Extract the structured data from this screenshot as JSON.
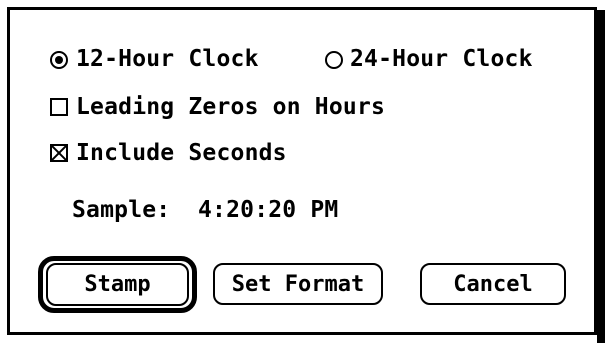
{
  "dialog": {
    "clock_options": [
      {
        "label": "12-Hour Clock",
        "selected": true
      },
      {
        "label": "24-Hour Clock",
        "selected": false
      }
    ],
    "leading_zeros": {
      "label": "Leading Zeros on Hours",
      "checked": false
    },
    "include_seconds": {
      "label": "Include Seconds",
      "checked": true
    },
    "sample": {
      "label": "Sample:",
      "value": "4:20:20 PM"
    },
    "buttons": {
      "stamp": "Stamp",
      "set_format": "Set Format",
      "cancel": "Cancel"
    }
  }
}
